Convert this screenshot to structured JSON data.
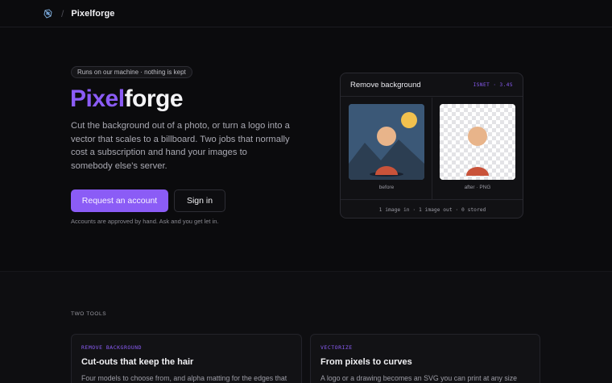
{
  "header": {
    "separator": "/",
    "brand": "Pixelforge"
  },
  "hero": {
    "badge": "Runs on our machine · nothing is kept",
    "title_part1": "Pixel",
    "title_part2": "forge",
    "lede": "Cut the background out of a photo, or turn a logo into a vector that scales to a billboard. Two jobs that normally cost a subscription and hand your images to somebody else's server.",
    "primary_cta": "Request an account",
    "secondary_cta": "Sign in",
    "note": "Accounts are approved by hand. Ask and you get let in."
  },
  "demo_card": {
    "title": "Remove background",
    "tag": "ISNET · 3.4S",
    "before_caption": "before",
    "after_caption": "after · PNG",
    "footer": "1 image in · 1 image out · 0 stored"
  },
  "tools_section": {
    "eyebrow": "TWO TOOLS",
    "tools": [
      {
        "kicker": "REMOVE BACKGROUND",
        "title": "Cut-outs that keep the hair",
        "description": "Four models to choose from, and alpha matting for the edges that"
      },
      {
        "kicker": "VECTORIZE",
        "title": "From pixels to curves",
        "description": "A logo or a drawing becomes an SVG you can print at any size"
      }
    ]
  },
  "colors": {
    "accent": "#8b5cf6",
    "background": "#0b0b0d",
    "sky": "#3b5877",
    "sun": "#f2c14e",
    "moon": "#e8b48a",
    "mountain": "#2c3e52",
    "mound": "#c9533a"
  },
  "icons": {
    "logo": "pixelforge-logo-icon"
  }
}
